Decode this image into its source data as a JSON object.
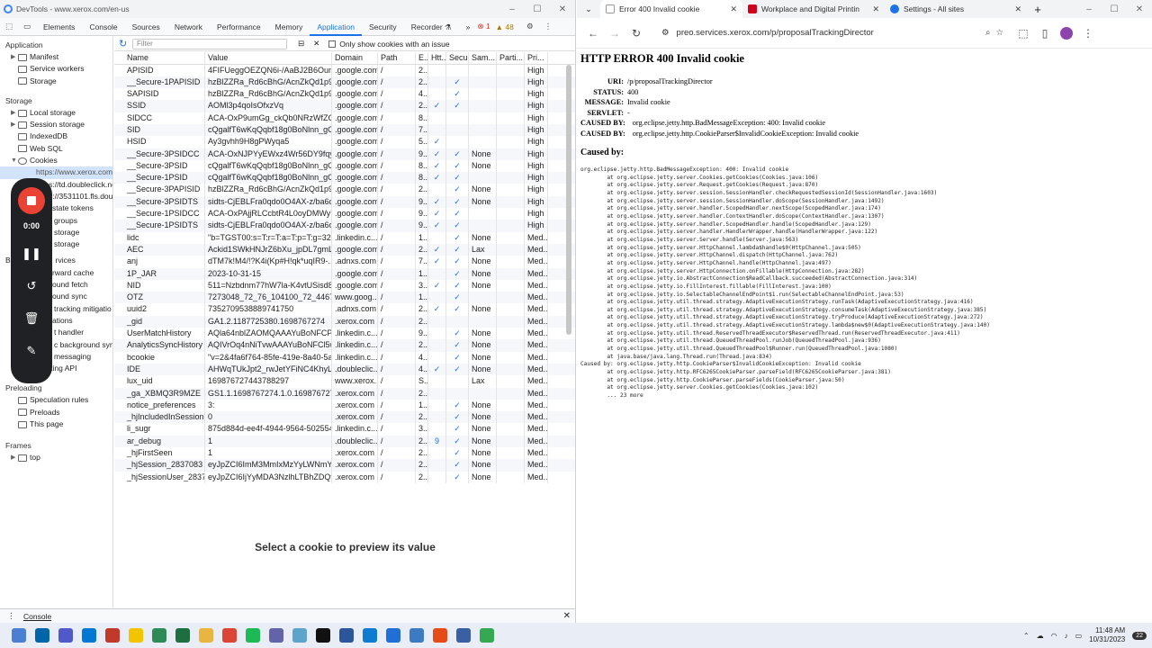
{
  "devtools": {
    "title": "DevTools - www.xerox.com/en-us",
    "tabs": [
      "Elements",
      "Console",
      "Sources",
      "Network",
      "Performance",
      "Memory",
      "Application",
      "Security",
      "Recorder ⚗"
    ],
    "active_tab": "Application",
    "more": "»",
    "errors": "1",
    "warnings": "48",
    "filter_placeholder": "Filter",
    "only_issue_label": "Only show cookies with an issue",
    "sidebar": {
      "application_header": "Application",
      "application_items": [
        "Manifest",
        "Service workers",
        "Storage"
      ],
      "storage_header": "Storage",
      "storage_items": [
        "Local storage",
        "Session storage",
        "IndexedDB",
        "Web SQL",
        "Cookies"
      ],
      "cookie_origins": [
        "https://www.xerox.com",
        "https://td.doubleclick.ne",
        "https://3531101.fls.doub"
      ],
      "more_storage": [
        "state tokens",
        "groups",
        "storage",
        "storage"
      ],
      "bg_header_partial": "B",
      "bg_items": [
        "rvices",
        "rward cache",
        "ound fetch",
        "ound sync",
        "ations",
        "t handler",
        "c background sync",
        "messaging",
        "Reporting API"
      ],
      "bounce_item": "tracking mitigatio",
      "preloading_header": "Preloading",
      "preloading_items": [
        "Speculation rules",
        "Preloads",
        "This page"
      ],
      "frames_header": "Frames",
      "frames_items": [
        "top"
      ]
    },
    "recorder": {
      "time": "0:00"
    },
    "columns": [
      "Name",
      "Value",
      "Domain",
      "Path",
      "E...",
      "Htt...",
      "Secu...",
      "Sam...",
      "Parti...",
      "Pri..."
    ],
    "cookies": [
      [
        "APISID",
        "4FIFUeggOEZQN6i-/AaBJ2B6Oun7jx...",
        ".google.com",
        "/",
        "2...",
        "",
        "",
        "",
        "",
        "High"
      ],
      [
        "__Secure-1PAPISID",
        "hzBlZZRa_Rd6cBhG/AcnZkQd1p9Xz...",
        ".google.com",
        "/",
        "2...",
        "",
        "✓",
        "",
        "",
        "High"
      ],
      [
        "SAPISID",
        "hzBlZZRa_Rd6cBhG/AcnZkQd1p9Xz...",
        ".google.com",
        "/",
        "4...",
        "",
        "✓",
        "",
        "",
        "High"
      ],
      [
        "SSID",
        "AOMl3p4qoIsOfxzVq",
        ".google.com",
        "/",
        "2...",
        "✓",
        "✓",
        "",
        "",
        "High"
      ],
      [
        "SIDCC",
        "ACA-OxP9umGg_ckQb0NRzWfZGPp...",
        ".google.com",
        "/",
        "8...",
        "",
        "",
        "",
        "",
        "High"
      ],
      [
        "SID",
        "cQgalfT6wKqQqbf18g0BoNlnn_gOIR...",
        ".google.com",
        "/",
        "7...",
        "",
        "",
        "",
        "",
        "High"
      ],
      [
        "HSID",
        "Ay3gvhh9H8gPWyqa5",
        ".google.com",
        "/",
        "5...",
        "✓",
        "",
        "",
        "",
        "High"
      ],
      [
        "__Secure-3PSIDCC",
        "ACA-OxNJPYyEWxz4Wr56DY9fqyxN...",
        ".google.com",
        "/",
        "9...",
        "✓",
        "✓",
        "None",
        "",
        "High"
      ],
      [
        "__Secure-3PSID",
        "cQgalfT6wKqQqbf18g0BoNlnn_gOIR...",
        ".google.com",
        "/",
        "8...",
        "✓",
        "✓",
        "None",
        "",
        "High"
      ],
      [
        "__Secure-1PSID",
        "cQgalfT6wKqQqbf18g0BoNlnn_gOIR...",
        ".google.com",
        "/",
        "8...",
        "✓",
        "✓",
        "",
        "",
        "High"
      ],
      [
        "__Secure-3PAPISID",
        "hzBlZZRa_Rd6cBhG/AcnZkQd1p9Xz...",
        ".google.com",
        "/",
        "2...",
        "",
        "✓",
        "None",
        "",
        "High"
      ],
      [
        "__Secure-3PSIDTS",
        "sidts-CjEBLFra0qdo0O4AX-z/ba6qU...",
        ".google.com",
        "/",
        "9...",
        "✓",
        "✓",
        "None",
        "",
        "High"
      ],
      [
        "__Secure-1PSIDCC",
        "ACA-OxPAjjRLCcbtR4L0oyDMWyYL...",
        ".google.com",
        "/",
        "9...",
        "✓",
        "✓",
        "",
        "",
        "High"
      ],
      [
        "__Secure-1PSIDTS",
        "sidts-CjEBLFra0qdo0O4AX-z/ba6qU...",
        ".google.com",
        "/",
        "9...",
        "✓",
        "✓",
        "",
        "",
        "High"
      ],
      [
        "lidc",
        "\"b=TGST00:s=T:r=T:a=T:p=T:g=3228...",
        ".linkedin.c...",
        "/",
        "1...",
        "",
        "✓",
        "None",
        "",
        "Med..."
      ],
      [
        "AEC",
        "Ackid1SWkHNJrZ6bXu_jpDL7gmL1Tl...",
        ".google.com",
        "/",
        "2...",
        "✓",
        "✓",
        "Lax",
        "",
        "Med..."
      ],
      [
        "anj",
        "dTM7k!M4/!?K4i(Kp#H!qk*uqIR9-...",
        ".adnxs.com",
        "/",
        "7...",
        "✓",
        "✓",
        "None",
        "",
        "Med..."
      ],
      [
        "1P_JAR",
        "2023-10-31-15",
        ".google.com",
        "/",
        "1...",
        "",
        "✓",
        "None",
        "",
        "Med..."
      ],
      [
        "NID",
        "511=Nzbdnm77hW7la-K4vtUSisd82...",
        ".google.com",
        "/",
        "3...",
        "✓",
        "✓",
        "None",
        "",
        "Med..."
      ],
      [
        "OTZ",
        "7273048_72_76_104100_72_446760",
        "www.goog...",
        "/",
        "1...",
        "",
        "✓",
        "",
        "",
        "Med..."
      ],
      [
        "uuid2",
        "7352709538889741750",
        ".adnxs.com",
        "/",
        "2...",
        "✓",
        "✓",
        "None",
        "",
        "Med..."
      ],
      [
        "_gid",
        "GA1.2.1187725380.1698767274",
        ".xerox.com",
        "/",
        "2...",
        "",
        "",
        "",
        "",
        "Med..."
      ],
      [
        "UserMatchHistory",
        "AQla64nblZAOMQAAAYuBoNFCPMl...",
        ".linkedin.c...",
        "/",
        "9...",
        "",
        "✓",
        "None",
        "",
        "Med..."
      ],
      [
        "AnalyticsSyncHistory",
        "AQIVrOq4nNiTvwAAAYuBoNFCl5wJf...",
        ".linkedin.c...",
        "/",
        "2...",
        "",
        "✓",
        "None",
        "",
        "Med..."
      ],
      [
        "bcookie",
        "\"v=2&4fa6f764-85fe-419e-8a40-5a6...",
        ".linkedin.c...",
        "/",
        "4...",
        "",
        "✓",
        "None",
        "",
        "Med..."
      ],
      [
        "IDE",
        "AHWqTUkJpt2_rwJetYFiNC4KhyLgtp...",
        ".doubleclic...",
        "/",
        "4...",
        "✓",
        "✓",
        "None",
        "",
        "Med..."
      ],
      [
        "lux_uid",
        "169876727443788297",
        "www.xerox...",
        "/",
        "S...",
        "",
        "",
        "Lax",
        "",
        "Med..."
      ],
      [
        "_ga_XBMQ3R9MZE",
        "GS1.1.1698767274.1.0.1698767274.0...",
        ".xerox.com",
        "/",
        "2...",
        "",
        "",
        "",
        "",
        "Med..."
      ],
      [
        "notice_preferences",
        "3:",
        ".xerox.com",
        "/",
        "1...",
        "",
        "✓",
        "None",
        "",
        "Med..."
      ],
      [
        "_hjIncludedInSession...",
        "0",
        ".xerox.com",
        "/",
        "2...",
        "",
        "✓",
        "None",
        "",
        "Med..."
      ],
      [
        "li_sugr",
        "875d884d-ee4f-4944-9564-502554d...",
        ".linkedin.c...",
        "/",
        "3...",
        "",
        "✓",
        "None",
        "",
        "Med..."
      ],
      [
        "ar_debug",
        "1",
        ".doubleclic...",
        "/",
        "2...",
        "9",
        "✓",
        "None",
        "",
        "Med..."
      ],
      [
        "_hjFirstSeen",
        "1",
        ".xerox.com",
        "/",
        "2...",
        "",
        "✓",
        "None",
        "",
        "Med..."
      ],
      [
        "_hjSession_2837083",
        "eyJpZCI6ImM3MmIxMzYyLWNmYz...",
        ".xerox.com",
        "/",
        "2...",
        "",
        "✓",
        "None",
        "",
        "Med..."
      ],
      [
        "_hjSessionUser_28370...",
        "eyJpZCI6IjYyMDA3NzlhLTBhZDQtNT...",
        ".xerox.com",
        "/",
        "2...",
        "",
        "✓",
        "None",
        "",
        "Med..."
      ]
    ],
    "preview_text": "Select a cookie to preview its value",
    "console_label": "Console"
  },
  "browser": {
    "tabs": [
      {
        "title": "Error 400 Invalid cookie",
        "active": true
      },
      {
        "title": "Workplace and Digital Printin",
        "active": false
      },
      {
        "title": "Settings - All sites",
        "active": false
      }
    ],
    "new_tab": "+",
    "url": "preo.services.xerox.com/p/proposalTrackingDirector",
    "page": {
      "heading": "HTTP ERROR 400 Invalid cookie",
      "fields": [
        {
          "k": "URI:",
          "v": "/p/proposalTrackingDirector"
        },
        {
          "k": "STATUS:",
          "v": "400"
        },
        {
          "k": "MESSAGE:",
          "v": "Invalid cookie"
        },
        {
          "k": "SERVLET:",
          "v": "-"
        }
      ],
      "caused_lines": [
        {
          "k": "CAUSED BY:",
          "v": "org.eclipse.jetty.http.BadMessageException: 400: Invalid cookie"
        },
        {
          "k": "CAUSED BY:",
          "v": "org.eclipse.jetty.http.CookieParser$InvalidCookieException: Invalid cookie"
        }
      ],
      "caused_heading": "Caused by:",
      "stack": "org.eclipse.jetty.http.BadMessageException: 400: Invalid cookie\n\tat org.eclipse.jetty.server.Cookies.getCookies(Cookies.java:106)\n\tat org.eclipse.jetty.server.Request.getCookies(Request.java:870)\n\tat org.eclipse.jetty.server.session.SessionHandler.checkRequestedSessionId(SessionHandler.java:1603)\n\tat org.eclipse.jetty.server.session.SessionHandler.doScope(SessionHandler.java:1492)\n\tat org.eclipse.jetty.server.handler.ScopedHandler.nextScope(ScopedHandler.java:174)\n\tat org.eclipse.jetty.server.handler.ContextHandler.doScope(ContextHandler.java:1307)\n\tat org.eclipse.jetty.server.handler.ScopedHandler.handle(ScopedHandler.java:129)\n\tat org.eclipse.jetty.server.handler.HandlerWrapper.handle(HandlerWrapper.java:122)\n\tat org.eclipse.jetty.server.Server.handle(Server.java:563)\n\tat org.eclipse.jetty.server.HttpChannel.lambda$handle$0(HttpChannel.java:505)\n\tat org.eclipse.jetty.server.HttpChannel.dispatch(HttpChannel.java:762)\n\tat org.eclipse.jetty.server.HttpChannel.handle(HttpChannel.java:497)\n\tat org.eclipse.jetty.server.HttpConnection.onFillable(HttpConnection.java:282)\n\tat org.eclipse.jetty.io.AbstractConnection$ReadCallback.succeeded(AbstractConnection.java:314)\n\tat org.eclipse.jetty.io.FillInterest.fillable(FillInterest.java:100)\n\tat org.eclipse.jetty.io.SelectableChannelEndPoint$1.run(SelectableChannelEndPoint.java:53)\n\tat org.eclipse.jetty.util.thread.strategy.AdaptiveExecutionStrategy.runTask(AdaptiveExecutionStrategy.java:416)\n\tat org.eclipse.jetty.util.thread.strategy.AdaptiveExecutionStrategy.consumeTask(AdaptiveExecutionStrategy.java:385)\n\tat org.eclipse.jetty.util.thread.strategy.AdaptiveExecutionStrategy.tryProduce(AdaptiveExecutionStrategy.java:272)\n\tat org.eclipse.jetty.util.thread.strategy.AdaptiveExecutionStrategy.lambda$new$0(AdaptiveExecutionStrategy.java:140)\n\tat org.eclipse.jetty.util.thread.ReservedThreadExecutor$ReservedThread.run(ReservedThreadExecutor.java:411)\n\tat org.eclipse.jetty.util.thread.QueuedThreadPool.runJob(QueuedThreadPool.java:936)\n\tat org.eclipse.jetty.util.thread.QueuedThreadPool$Runner.run(QueuedThreadPool.java:1080)\n\tat java.base/java.lang.Thread.run(Thread.java:834)\nCaused by: org.eclipse.jetty.http.CookieParser$InvalidCookieException: Invalid cookie\n\tat org.eclipse.jetty.http.RFC6265CookieParser.parseField(RFC6265CookieParser.java:381)\n\tat org.eclipse.jetty.http.CookieParser.parseFields(CookieParser.java:50)\n\tat org.eclipse.jetty.server.Cookies.getCookies(Cookies.java:102)\n\t... 23 more"
    }
  },
  "taskbar": {
    "apps": [
      {
        "name": "vscode-icon",
        "color": "#0065a9"
      },
      {
        "name": "teams-icon",
        "color": "#5059c9"
      },
      {
        "name": "outlook-icon",
        "color": "#0078d4"
      },
      {
        "name": "app-red-icon",
        "color": "#c0392b"
      },
      {
        "name": "notes-icon",
        "color": "#f2c500"
      },
      {
        "name": "app-green-icon",
        "color": "#2e8b57"
      },
      {
        "name": "excel-icon",
        "color": "#1d6f42"
      },
      {
        "name": "folder-icon",
        "color": "#e8b640"
      },
      {
        "name": "chrome-icon",
        "color": "#db4437"
      },
      {
        "name": "spotify-icon",
        "color": "#1db954"
      },
      {
        "name": "app-purple-icon",
        "color": "#6264a7"
      },
      {
        "name": "app-teal-icon",
        "color": "#5ea3c9"
      },
      {
        "name": "mx-icon",
        "color": "#111111"
      },
      {
        "name": "word-icon",
        "color": "#2b579a"
      },
      {
        "name": "edge-icon",
        "color": "#0c7bd1"
      },
      {
        "name": "app-circle-icon",
        "color": "#1f6fd6"
      },
      {
        "name": "monitor-icon",
        "color": "#3c7ac3"
      },
      {
        "name": "pdf-icon",
        "color": "#e64a19"
      },
      {
        "name": "s-app-icon",
        "color": "#3a5fa3"
      },
      {
        "name": "chrome2-icon",
        "color": "#34a853"
      }
    ],
    "time": "11:48 AM",
    "date": "10/31/2023",
    "notif": "22"
  }
}
